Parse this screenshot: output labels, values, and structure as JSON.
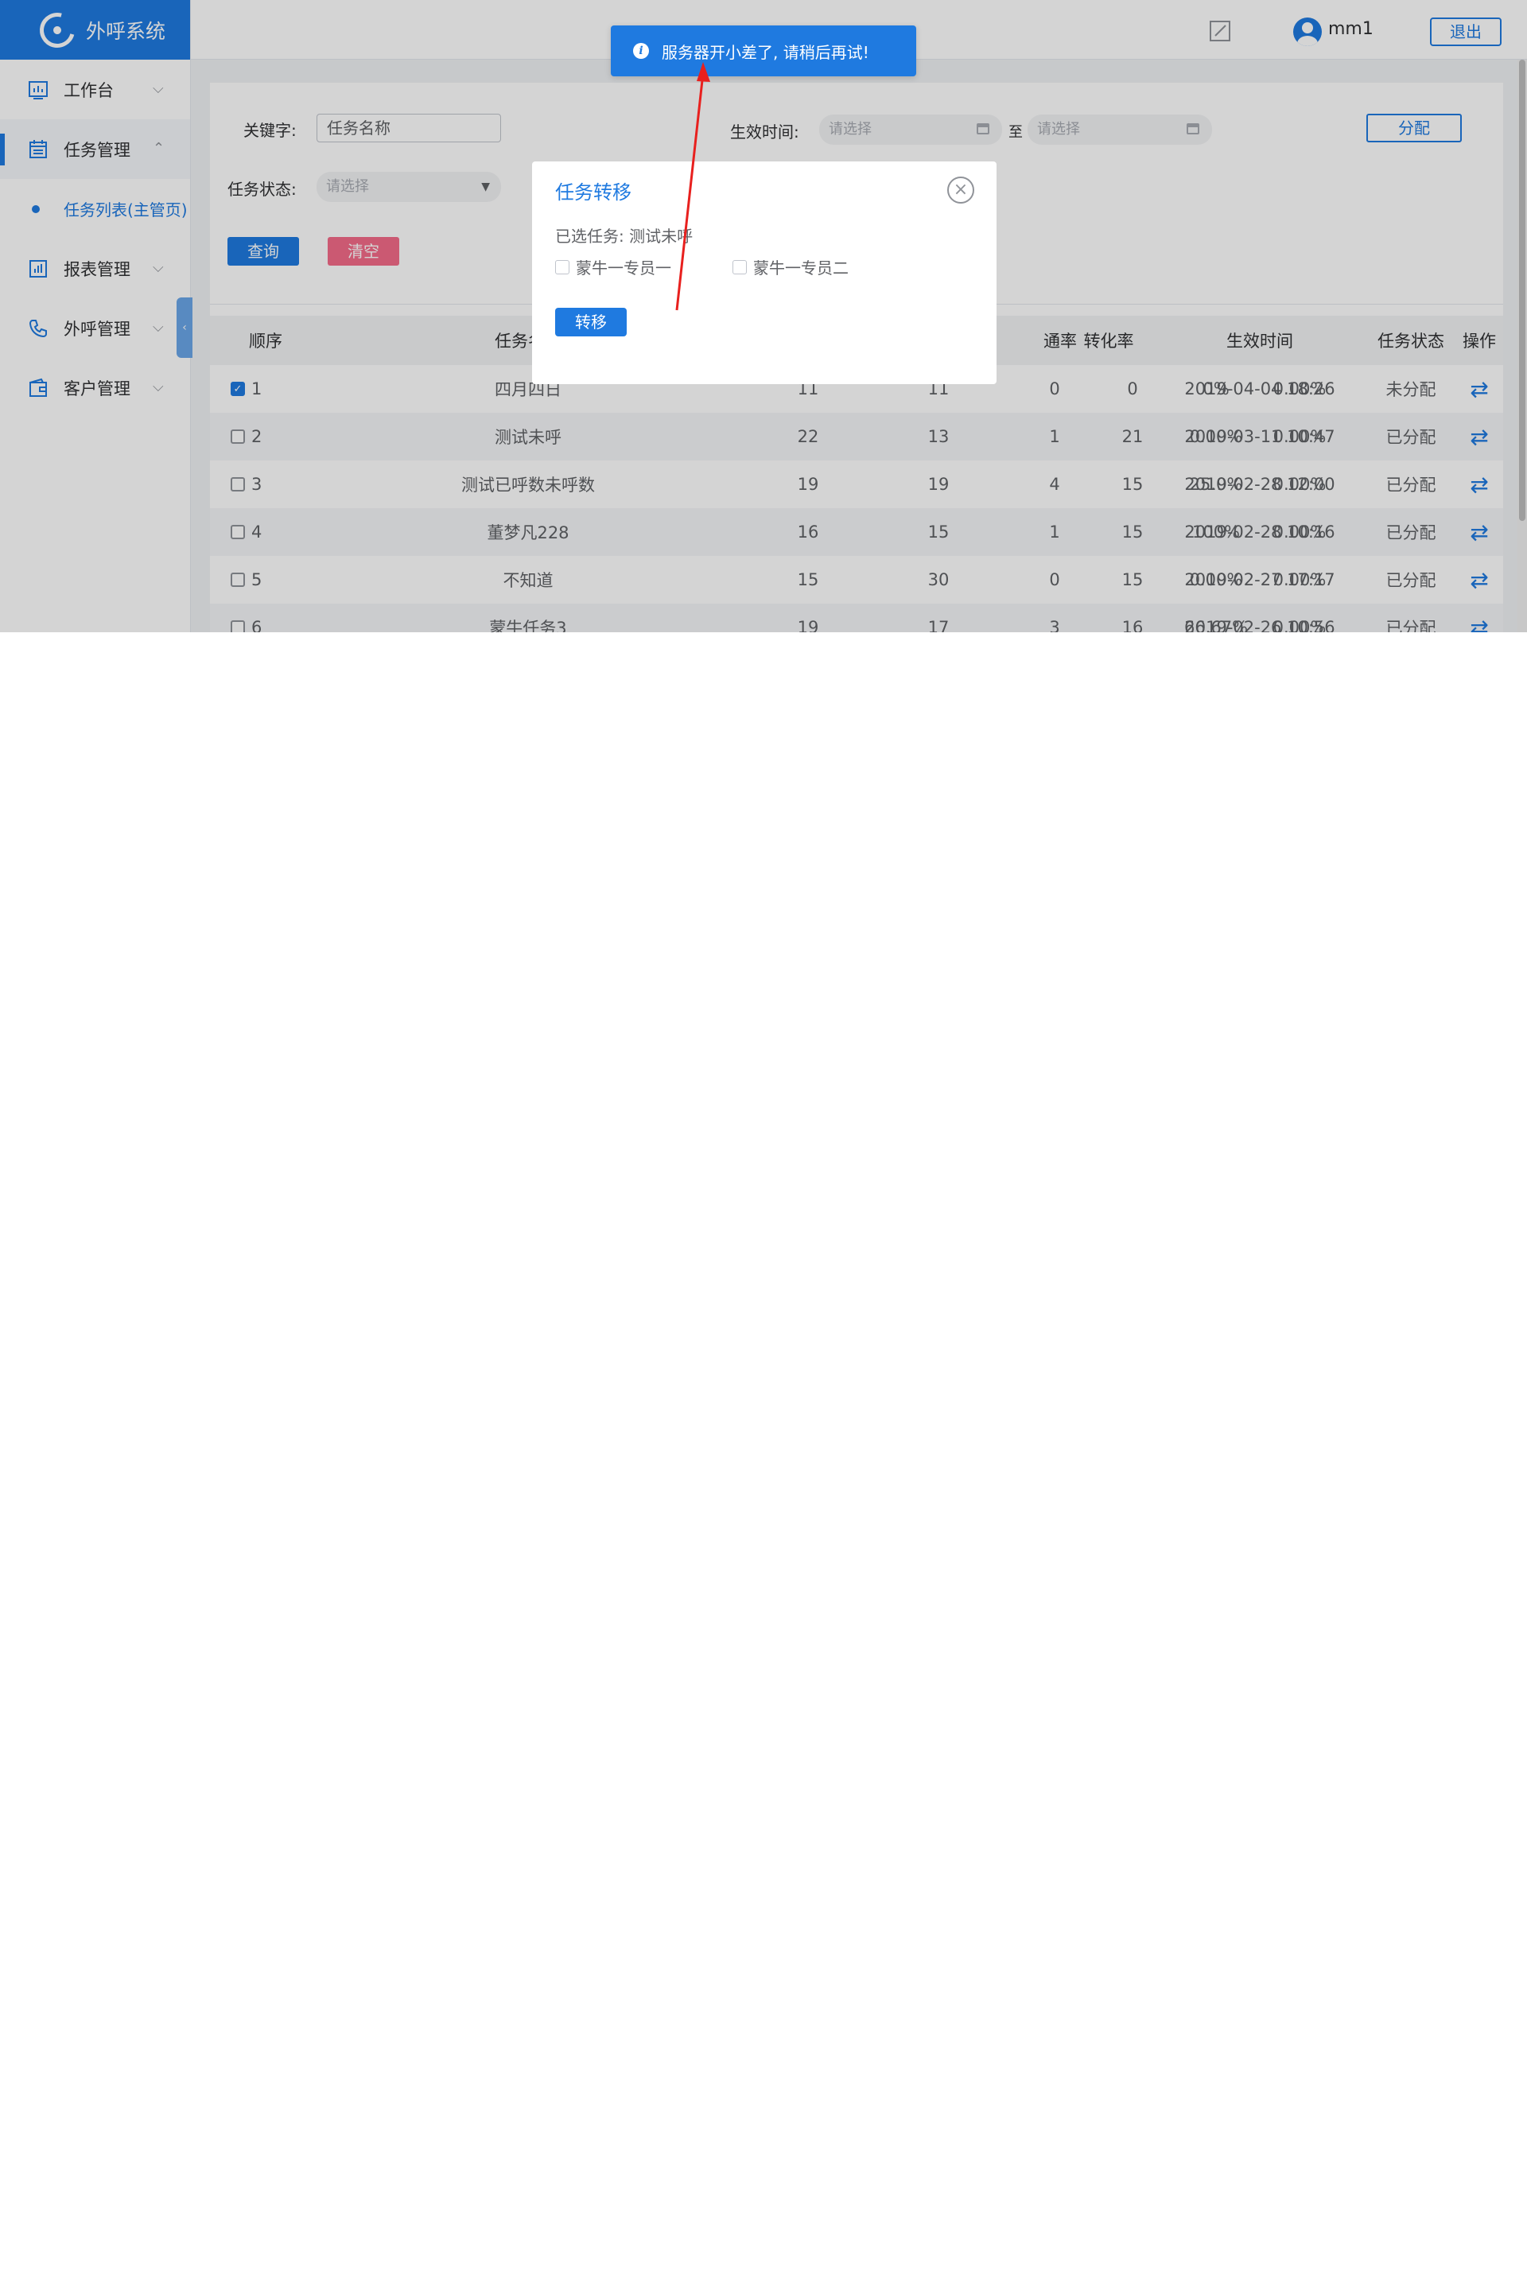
{
  "app": {
    "title": "外呼系统"
  },
  "sidebar": {
    "items": [
      {
        "label": "工作台",
        "icon": "dashboard-icon",
        "chevron": "⌵"
      },
      {
        "label": "任务管理",
        "icon": "calendar-icon",
        "chevron": "⌃"
      },
      {
        "label": "报表管理",
        "icon": "report-icon",
        "chevron": "⌵"
      },
      {
        "label": "外呼管理",
        "icon": "phone-icon",
        "chevron": "⌵"
      },
      {
        "label": "客户管理",
        "icon": "wallet-icon",
        "chevron": "⌵"
      }
    ],
    "sub_item": "任务列表(主管页)",
    "collapse_glyph": "‹"
  },
  "header": {
    "username": "mm1",
    "logout": "退出",
    "edit_icon": "edit-icon"
  },
  "filters": {
    "keyword_label": "关键字:",
    "keyword_placeholder": "任务名称",
    "status_label": "任务状态:",
    "status_placeholder": "请选择",
    "time_label": "生效时间:",
    "time_start_placeholder": "请选择",
    "time_sep": "至",
    "time_end_placeholder": "请选择",
    "query_btn": "查询",
    "clear_btn": "清空",
    "assign_btn": "分配"
  },
  "table": {
    "headers": [
      "顺序",
      "任务名称",
      "通率",
      "转化率",
      "生效时间",
      "任务状态",
      "操作"
    ],
    "rows": [
      {
        "no": "1",
        "checked": true,
        "name": "四月四日",
        "c1": "11",
        "c2": "11",
        "c3": "0",
        "c4": "0",
        "rate": "0%",
        "conv": "0.00%",
        "time": "2019-04-04 18:26",
        "status": "未分配"
      },
      {
        "no": "2",
        "checked": false,
        "name": "测试未呼",
        "c1": "22",
        "c2": "13",
        "c3": "1",
        "c4": "21",
        "rate": "0.00%",
        "conv": "0.00%",
        "time": "2019-03-11 10:47",
        "status": "已分配"
      },
      {
        "no": "3",
        "checked": false,
        "name": "测试已呼数未呼数",
        "c1": "19",
        "c2": "19",
        "c3": "4",
        "c4": "15",
        "rate": "25.0%",
        "conv": "0.00%",
        "time": "2019-02-28 12:00",
        "status": "已分配"
      },
      {
        "no": "4",
        "checked": false,
        "name": "董梦凡228",
        "c1": "16",
        "c2": "15",
        "c3": "1",
        "c4": "15",
        "rate": "100%",
        "conv": "0.00%",
        "time": "2019-02-28 10:16",
        "status": "已分配"
      },
      {
        "no": "5",
        "checked": false,
        "name": "不知道",
        "c1": "15",
        "c2": "30",
        "c3": "0",
        "c4": "15",
        "rate": "0.00%",
        "conv": "0.00%",
        "time": "2019-02-27 17:17",
        "status": "已分配"
      },
      {
        "no": "6",
        "checked": false,
        "name": "蒙牛任务3",
        "c1": "19",
        "c2": "17",
        "c3": "3",
        "c4": "16",
        "rate": "66.67%",
        "conv": "0.00%",
        "time": "2019-02-26 10:56",
        "status": "已分配"
      }
    ],
    "op_glyph": "⇄",
    "check_glyph": "✓"
  },
  "modal": {
    "title": "任务转移",
    "selected_label": "已选任务: 测试未呼",
    "options": [
      "蒙牛一专员一",
      "蒙牛一专员二"
    ],
    "submit": "转移",
    "close_glyph": "×"
  },
  "toast": {
    "icon": "i",
    "message": "服务器开小差了, 请稍后再试!"
  },
  "colors": {
    "primary": "#1f7ae0",
    "danger": "#f56c8a",
    "annotation": "#e8201e"
  }
}
